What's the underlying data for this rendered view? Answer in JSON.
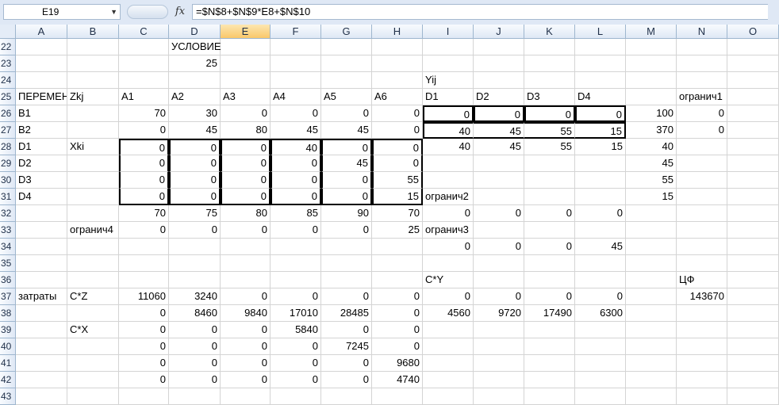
{
  "formula_bar": {
    "name_box": "E19",
    "fx_label": "fx",
    "formula": "=$N$8+$N$9*E8+$N$10"
  },
  "sheet": {
    "selected_column": "E",
    "columns": [
      "A",
      "B",
      "C",
      "D",
      "E",
      "F",
      "G",
      "H",
      "I",
      "J",
      "K",
      "L",
      "M",
      "N",
      "O"
    ],
    "rows": [
      {
        "n": "22",
        "cells": {
          "D": "УСЛОВИЕ"
        }
      },
      {
        "n": "23",
        "cells": {
          "D": "25"
        }
      },
      {
        "n": "24",
        "cells": {
          "I": "Yij"
        }
      },
      {
        "n": "25",
        "cells": {
          "A": "ПЕРЕМЕНН",
          "B": "Zkj",
          "C": "A1",
          "D": "A2",
          "E": "A3",
          "F": "A4",
          "G": "A5",
          "H": "A6",
          "I": "D1",
          "J": "D2",
          "K": "D3",
          "L": "D4",
          "N": "огранич1"
        }
      },
      {
        "n": "26",
        "cells": {
          "A": "B1",
          "C": "70",
          "D": "30",
          "E": "0",
          "F": "0",
          "G": "0",
          "H": "0",
          "I": "0",
          "J": "0",
          "K": "0",
          "L": "0",
          "M": "100",
          "N": "0"
        }
      },
      {
        "n": "27",
        "cells": {
          "A": "B2",
          "C": "0",
          "D": "45",
          "E": "80",
          "F": "45",
          "G": "45",
          "H": "0",
          "I": "40",
          "J": "45",
          "K": "55",
          "L": "15",
          "M": "370",
          "N": "0"
        }
      },
      {
        "n": "28",
        "cells": {
          "A": "D1",
          "B": "Xki",
          "C": "0",
          "D": "0",
          "E": "0",
          "F": "40",
          "G": "0",
          "H": "0",
          "I": "40",
          "J": "45",
          "K": "55",
          "L": "15",
          "M": "40"
        }
      },
      {
        "n": "29",
        "cells": {
          "A": "D2",
          "C": "0",
          "D": "0",
          "E": "0",
          "F": "0",
          "G": "45",
          "H": "0",
          "M": "45"
        }
      },
      {
        "n": "30",
        "cells": {
          "A": "D3",
          "C": "0",
          "D": "0",
          "E": "0",
          "F": "0",
          "G": "0",
          "H": "55",
          "M": "55"
        }
      },
      {
        "n": "31",
        "cells": {
          "A": "D4",
          "C": "0",
          "D": "0",
          "E": "0",
          "F": "0",
          "G": "0",
          "H": "15",
          "I": "огранич2",
          "M": "15"
        }
      },
      {
        "n": "32",
        "cells": {
          "C": "70",
          "D": "75",
          "E": "80",
          "F": "85",
          "G": "90",
          "H": "70",
          "I": "0",
          "J": "0",
          "K": "0",
          "L": "0"
        }
      },
      {
        "n": "33",
        "cells": {
          "B": "огранич4",
          "C": "0",
          "D": "0",
          "E": "0",
          "F": "0",
          "G": "0",
          "H": "25",
          "I": "огранич3"
        }
      },
      {
        "n": "34",
        "cells": {
          "I": "0",
          "J": "0",
          "K": "0",
          "L": "45"
        }
      },
      {
        "n": "35",
        "cells": {}
      },
      {
        "n": "36",
        "cells": {
          "I": "C*Y",
          "N": "ЦФ"
        }
      },
      {
        "n": "37",
        "cells": {
          "A": "затраты",
          "B": "C*Z",
          "C": "11060",
          "D": "3240",
          "E": "0",
          "F": "0",
          "G": "0",
          "H": "0",
          "I": "0",
          "J": "0",
          "K": "0",
          "L": "0",
          "N": "143670"
        }
      },
      {
        "n": "38",
        "cells": {
          "C": "0",
          "D": "8460",
          "E": "9840",
          "F": "17010",
          "G": "28485",
          "H": "0",
          "I": "4560",
          "J": "9720",
          "K": "17490",
          "L": "6300"
        }
      },
      {
        "n": "39",
        "cells": {
          "B": "C*X",
          "C": "0",
          "D": "0",
          "E": "0",
          "F": "5840",
          "G": "0",
          "H": "0"
        }
      },
      {
        "n": "40",
        "cells": {
          "C": "0",
          "D": "0",
          "E": "0",
          "F": "0",
          "G": "7245",
          "H": "0"
        }
      },
      {
        "n": "41",
        "cells": {
          "C": "0",
          "D": "0",
          "E": "0",
          "F": "0",
          "G": "0",
          "H": "9680"
        }
      },
      {
        "n": "42",
        "cells": {
          "C": "0",
          "D": "0",
          "E": "0",
          "F": "0",
          "G": "0",
          "H": "4740"
        }
      },
      {
        "n": "43",
        "cells": {}
      }
    ]
  }
}
